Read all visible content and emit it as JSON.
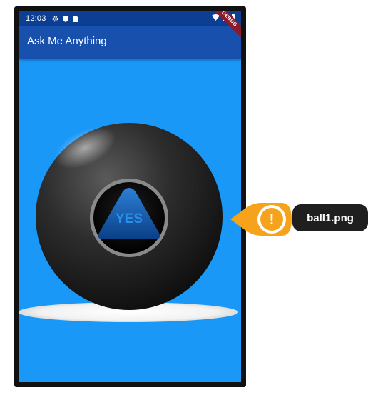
{
  "status_bar": {
    "time": "12:03"
  },
  "app_bar": {
    "title": "Ask Me Anything",
    "debug_banner": "DEBUG"
  },
  "ball": {
    "answer": "YES"
  },
  "callout": {
    "filename": "ball1.png",
    "icon": "!"
  },
  "colors": {
    "status_bar": "#0c3f93",
    "app_bar": "#1751ad",
    "background": "#1a98f8",
    "callout_orange": "#f7a21b",
    "callout_label": "#1f1f1f"
  }
}
